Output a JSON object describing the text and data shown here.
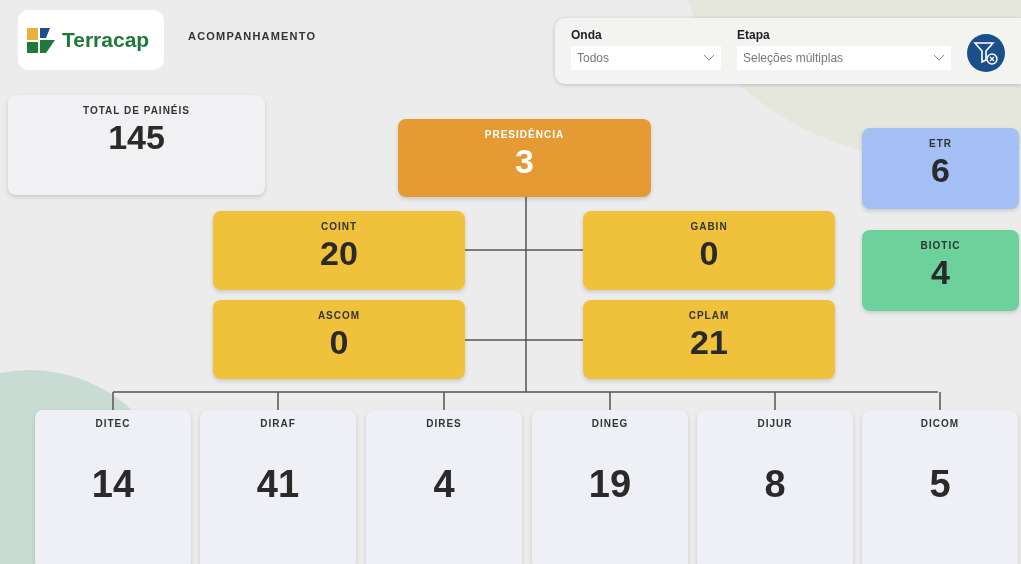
{
  "header": {
    "logo_text": "Terracap",
    "title": "ACOMPANHAMENTO"
  },
  "filters": [
    {
      "label": "Onda",
      "value": "Todos"
    },
    {
      "label": "Etapa",
      "value": "Seleções múltiplas"
    }
  ],
  "total": {
    "label": "TOTAL DE PAINÉIS",
    "value": "145"
  },
  "presidencia": {
    "name": "PRESIDÊNCIA",
    "value": "3"
  },
  "assessorias": [
    {
      "name": "COINT",
      "value": "20"
    },
    {
      "name": "GABIN",
      "value": "0"
    },
    {
      "name": "ASCOM",
      "value": "0"
    },
    {
      "name": "CPLAM",
      "value": "21"
    }
  ],
  "side": [
    {
      "name": "ETR",
      "value": "6",
      "color": "#a4bff3"
    },
    {
      "name": "BIOTIC",
      "value": "4",
      "color": "#6dd19b"
    }
  ],
  "diretorias": [
    {
      "name": "DITEC",
      "value": "14"
    },
    {
      "name": "DIRAF",
      "value": "41"
    },
    {
      "name": "DIRES",
      "value": "4"
    },
    {
      "name": "DINEG",
      "value": "19"
    },
    {
      "name": "DIJUR",
      "value": "8"
    },
    {
      "name": "DICOM",
      "value": "5"
    }
  ]
}
